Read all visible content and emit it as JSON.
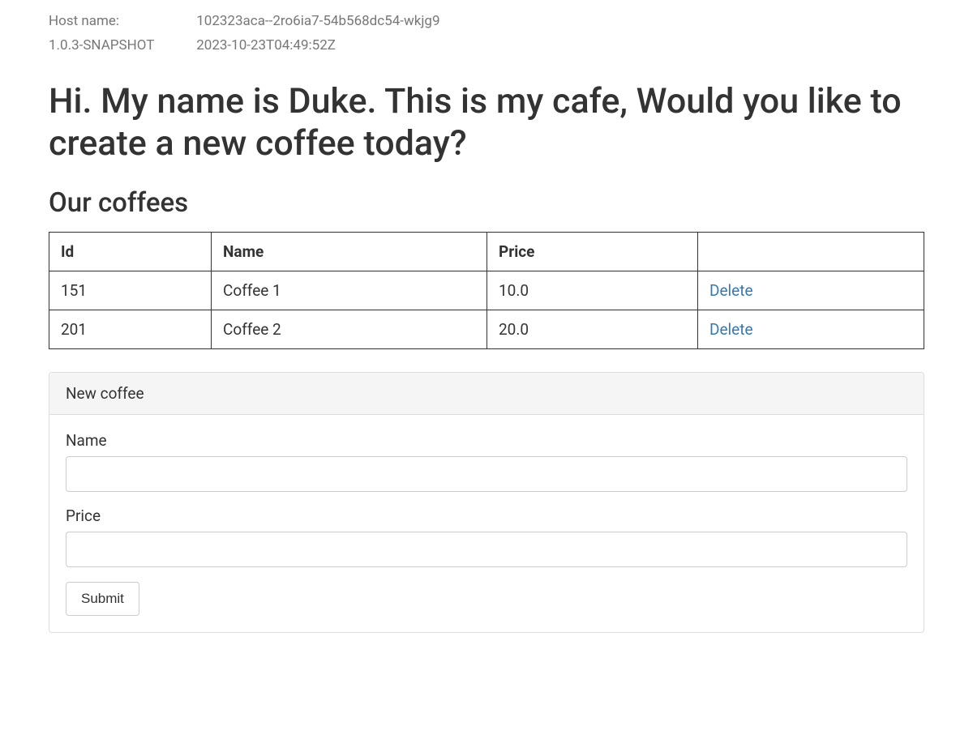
{
  "meta": {
    "host_label": "Host name:",
    "host_value": "102323aca--2ro6ia7-54b568dc54-wkjg9",
    "version_label": "1.0.3-SNAPSHOT",
    "build_time": "2023-10-23T04:49:52Z"
  },
  "greeting": "Hi. My name is Duke. This is my cafe, Would you like to create a new coffee today?",
  "coffee_section": {
    "heading": "Our coffees",
    "columns": {
      "id": "Id",
      "name": "Name",
      "price": "Price",
      "actions": ""
    },
    "rows": [
      {
        "id": "151",
        "name": "Coffee 1",
        "price": "10.0",
        "delete_label": "Delete"
      },
      {
        "id": "201",
        "name": "Coffee 2",
        "price": "20.0",
        "delete_label": "Delete"
      }
    ]
  },
  "form": {
    "panel_title": "New coffee",
    "name_label": "Name",
    "name_value": "",
    "price_label": "Price",
    "price_value": "",
    "submit_label": "Submit"
  }
}
